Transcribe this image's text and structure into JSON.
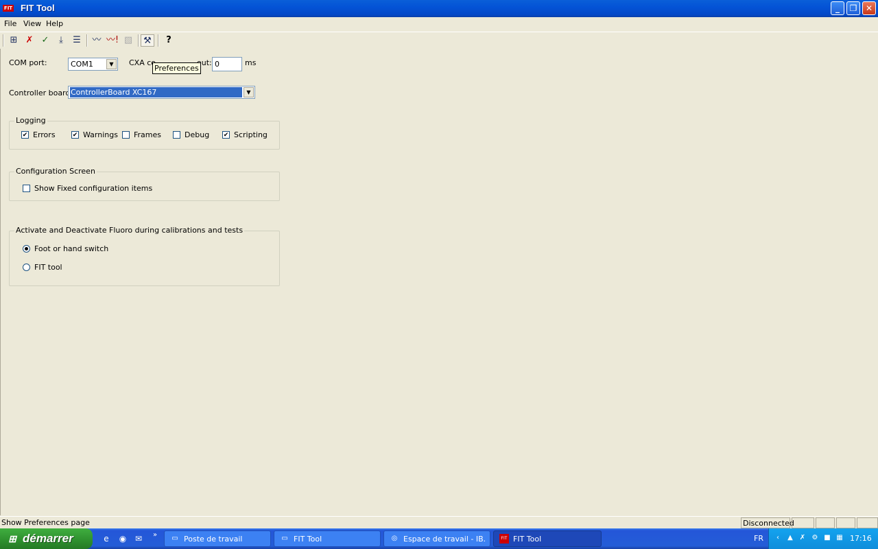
{
  "window": {
    "title": "FIT Tool",
    "app_icon_text": "FIT"
  },
  "menu": [
    "File",
    "View",
    "Help"
  ],
  "toolbar": {
    "icons": [
      "connect-icon",
      "cross-check-icon",
      "check-icon",
      "download-icon",
      "script-icon",
      "graph-icon",
      "graph-alert-icon",
      "chart-disabled-icon",
      "hammer-icon",
      "help-icon"
    ],
    "tooltip": "Preferences"
  },
  "prefs": {
    "com_port_label": "COM port:",
    "com_port_value": "COM1",
    "cxa_label": "CXA co",
    "cxa_label_tail": "out:",
    "cxa_value": "0",
    "cxa_unit": "ms",
    "controller_label": "Controller board:",
    "controller_value": "ControllerBoard XC167"
  },
  "logging": {
    "title": "Logging",
    "items": [
      {
        "label": "Errors",
        "checked": true
      },
      {
        "label": "Warnings",
        "checked": true
      },
      {
        "label": "Frames",
        "checked": false
      },
      {
        "label": "Debug",
        "checked": false
      },
      {
        "label": "Scripting",
        "checked": true
      }
    ]
  },
  "config_screen": {
    "title": "Configuration Screen",
    "show_fixed_label": "Show Fixed configuration items",
    "show_fixed_checked": false
  },
  "fluoro": {
    "title": "Activate and Deactivate Fluoro during calibrations and tests",
    "options": [
      {
        "label": "Foot or hand switch",
        "selected": true
      },
      {
        "label": "FIT tool",
        "selected": false
      }
    ]
  },
  "statusbar": {
    "text": "Show Preferences page",
    "connection": "Disconnected"
  },
  "taskbar": {
    "start_label": "démarrer",
    "tasks": [
      {
        "label": "Poste de travail",
        "icon": "folder-icon"
      },
      {
        "label": "FIT Tool",
        "icon": "folder-icon"
      },
      {
        "label": "Espace de travail - IB...",
        "icon": "app-icon"
      },
      {
        "label": "FIT Tool",
        "icon": "fit-icon"
      }
    ],
    "lang": "FR",
    "time": "17:16"
  }
}
